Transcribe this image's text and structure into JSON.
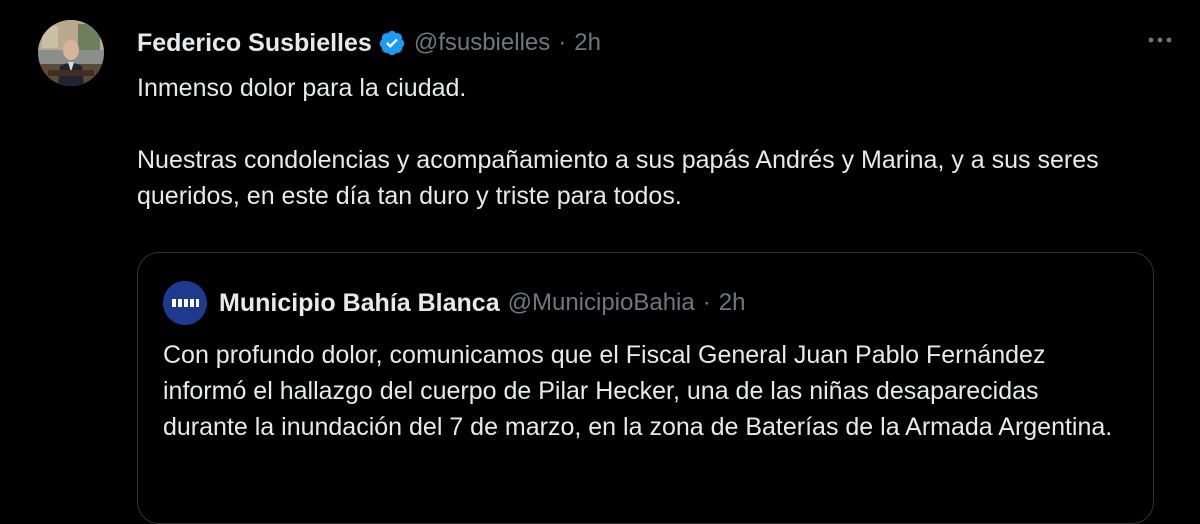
{
  "tweet": {
    "author_name": "Federico Susbielles",
    "author_handle": "@fsusbielles",
    "separator": "·",
    "time": "2h",
    "verified_icon": "verified-badge-icon",
    "more_icon": "more-options-icon",
    "body_line1": "Inmenso dolor para la ciudad.",
    "body_line2": "Nuestras condolencias y acompañamiento a sus papás Andrés y Marina, y a sus seres queridos, en este día tan duro y triste para todos."
  },
  "quoted_tweet": {
    "author_name": "Municipio Bahía Blanca",
    "author_handle": "@MunicipioBahia",
    "separator": "·",
    "time": "2h",
    "body": "Con profundo dolor, comunicamos que el Fiscal General Juan Pablo Fernández informó el hallazgo del cuerpo de Pilar Hecker, una de las niñas desaparecidas durante la inundación del 7 de marzo, en la zona de Baterías de la Armada Argentina."
  },
  "colors": {
    "background": "#000000",
    "primary_text": "#e7e9ea",
    "secondary_text": "#71767b",
    "verified_blue": "#1d9bf0",
    "border": "#2f3336"
  }
}
